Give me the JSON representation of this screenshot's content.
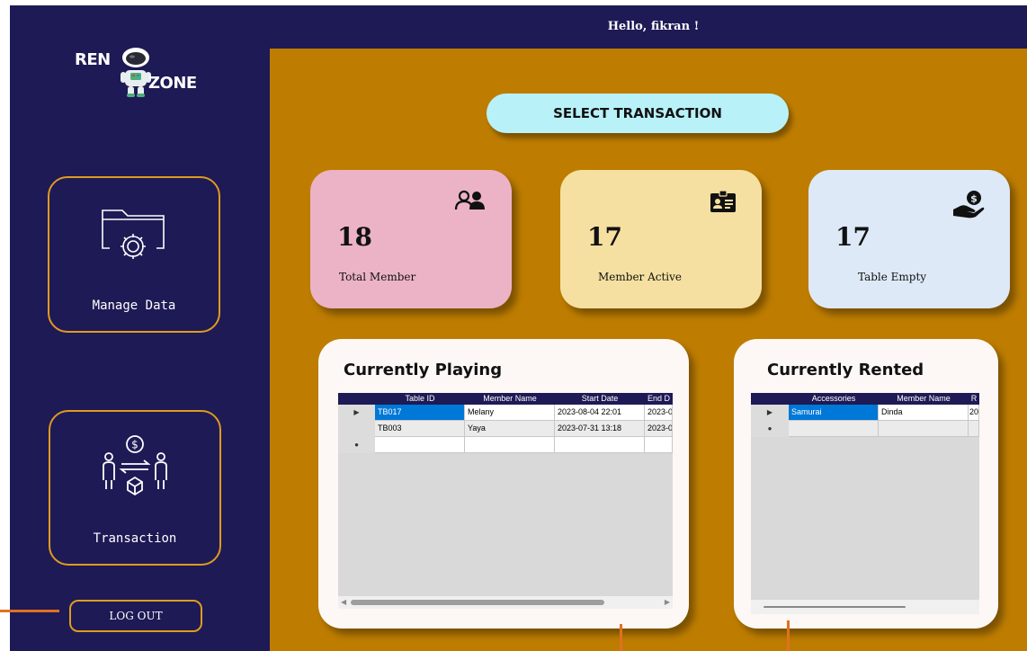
{
  "header": {
    "greeting": "Hello, fikran !"
  },
  "logo": {
    "part1": "REN",
    "part2": "ZONE"
  },
  "nav": {
    "manage_label": "Manage Data",
    "transaction_label": "Transaction",
    "logout_label": "LOG OUT"
  },
  "main": {
    "select_transaction_label": "SELECT TRANSACTION",
    "stats": [
      {
        "value": "18",
        "label": "Total Member",
        "icon": "users-icon"
      },
      {
        "value": "17",
        "label": "Member Active",
        "icon": "id-card-icon"
      },
      {
        "value": "17",
        "label": "Table Empty",
        "icon": "money-hand-icon"
      }
    ],
    "playing": {
      "title": "Currently Playing",
      "columns": [
        "Table ID",
        "Member Name",
        "Start Date",
        "End D"
      ],
      "rows": [
        [
          "TB017",
          "Melany",
          "2023-08-04 22:01",
          "2023-0"
        ],
        [
          "TB003",
          "Yaya",
          "2023-07-31 13:18",
          "2023-0"
        ]
      ]
    },
    "rented": {
      "title": "Currently Rented",
      "columns": [
        "Accessories",
        "Member Name",
        "R"
      ],
      "rows": [
        [
          "Samurai",
          "Dinda",
          "20"
        ]
      ]
    }
  },
  "colors": {
    "sidebar_bg": "#1e1a55",
    "main_bg": "#be7d00",
    "accent_border": "#e09a1f",
    "button_cyan": "#b8f2f8",
    "card_pink": "#ecb3c6",
    "card_yellow": "#f5e0a1",
    "card_blue": "#dde9f7",
    "selection_blue": "#0078d7"
  }
}
